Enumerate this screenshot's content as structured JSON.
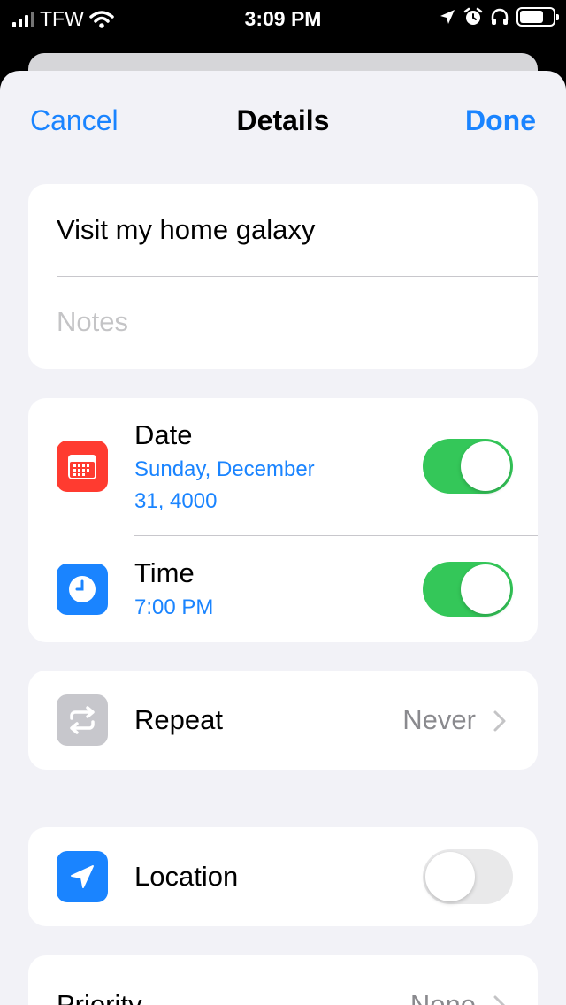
{
  "status_bar": {
    "carrier": "TFW",
    "time": "3:09 PM",
    "icons": [
      "signal-bars-icon",
      "wifi-icon",
      "location-arrow-icon",
      "alarm-icon",
      "headphones-icon",
      "battery-icon"
    ]
  },
  "nav": {
    "cancel_label": "Cancel",
    "title": "Details",
    "done_label": "Done"
  },
  "reminder": {
    "title": "Visit my home galaxy",
    "notes_placeholder": "Notes"
  },
  "date_row": {
    "label": "Date",
    "value_line1": "Sunday, December",
    "value_line2": "31, 4000",
    "toggle_on": true,
    "icon": "calendar-icon",
    "icon_color": "#ff3b30"
  },
  "time_row": {
    "label": "Time",
    "value": "7:00 PM",
    "toggle_on": true,
    "icon": "clock-icon",
    "icon_color": "#1a84ff"
  },
  "repeat_row": {
    "label": "Repeat",
    "value": "Never",
    "icon": "repeat-icon",
    "icon_color": "#c7c7cc"
  },
  "location_row": {
    "label": "Location",
    "toggle_on": false,
    "icon": "location-arrow-icon",
    "icon_color": "#1a84ff"
  },
  "priority_row": {
    "label": "Priority",
    "value": "None"
  },
  "colors": {
    "accent": "#1a84ff",
    "toggle_on": "#34c759",
    "background": "#f2f2f7"
  }
}
